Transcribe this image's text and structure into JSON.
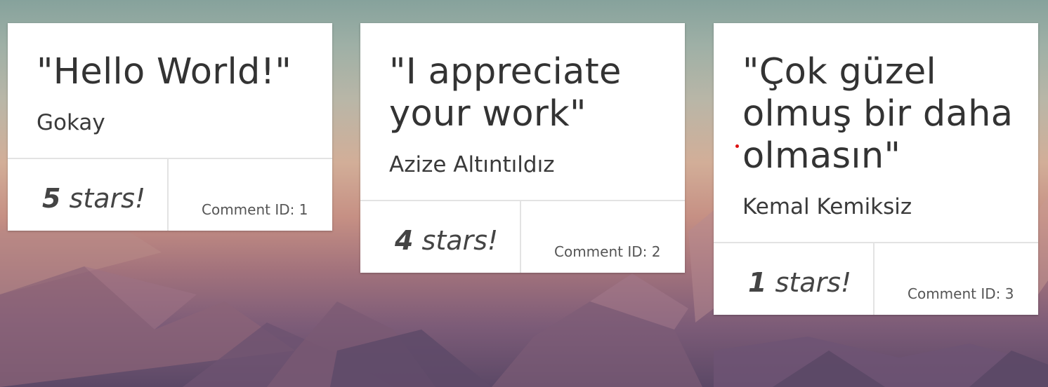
{
  "background": {
    "sky_color": "#86a29c",
    "horizon_color": "#d2ae98",
    "mountain_color": "#5b4866"
  },
  "comments": [
    {
      "quote": "\"Hello World!\"",
      "author": "Gokay",
      "stars": "5",
      "stars_suffix": " stars!",
      "comment_id": "Comment ID: 1"
    },
    {
      "quote": "\"I appreciate your work\"",
      "author": "Azize Altıntıldız",
      "stars": "4",
      "stars_suffix": " stars!",
      "comment_id": "Comment ID: 2"
    },
    {
      "quote": "\"Çok güzel olmuş bir daha olmasın\"",
      "author": "Kemal Kemiksiz",
      "stars": "1",
      "stars_suffix": " stars!",
      "comment_id": "Comment ID: 3"
    }
  ]
}
